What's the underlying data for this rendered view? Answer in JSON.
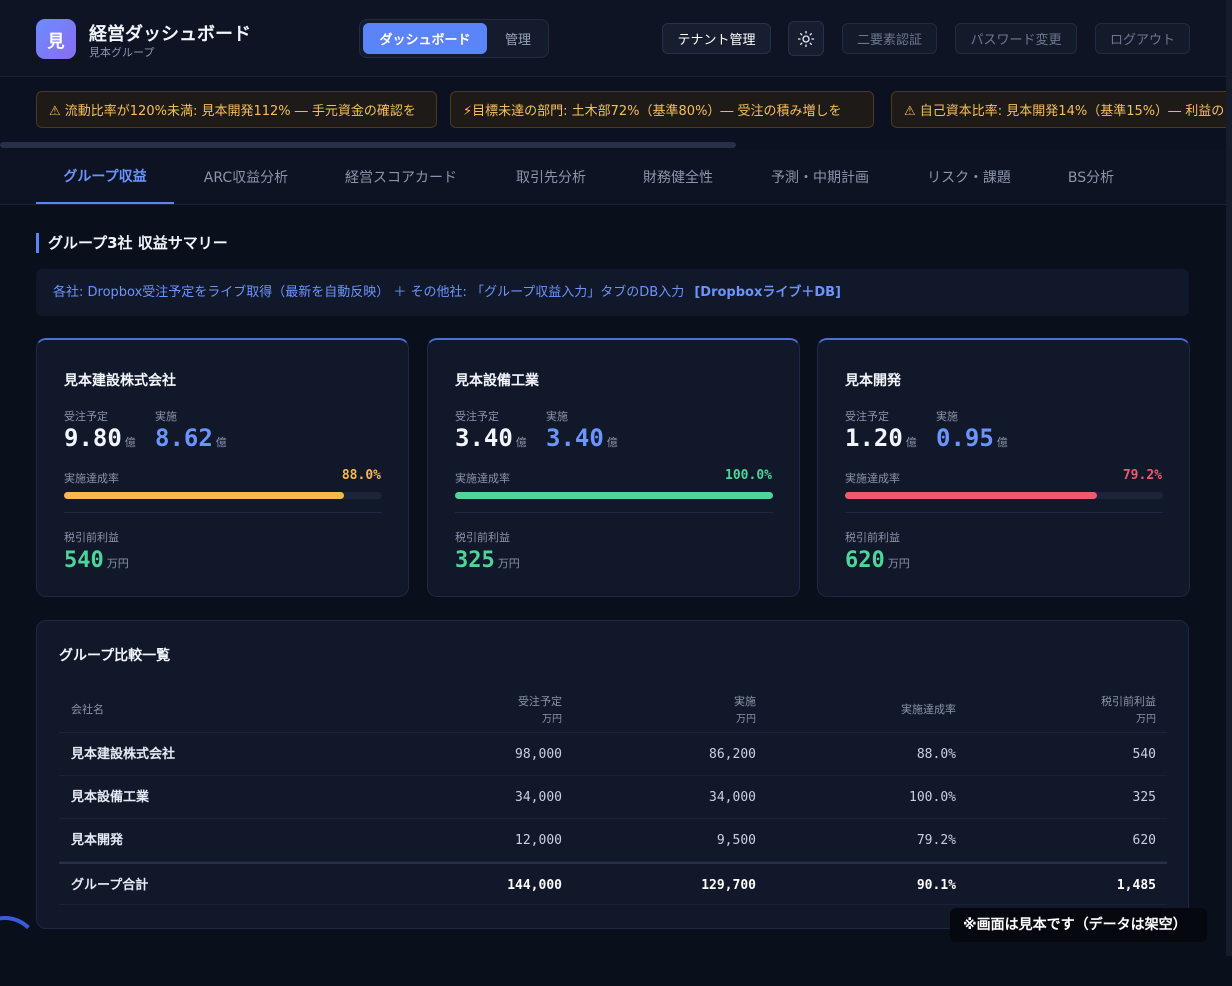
{
  "header": {
    "logo_char": "見",
    "title": "経営ダッシュボード",
    "subtitle": "見本グループ",
    "mode_tabs": [
      "ダッシュボード",
      "管理"
    ],
    "tenant_button": "テナント管理",
    "theme_icon": "sun-icon",
    "buttons": [
      "二要素認証",
      "パスワード変更",
      "ログアウト"
    ]
  },
  "alerts": [
    "⚠ 流動比率が120%未満: 見本開発112% ― 手元資金の確認を",
    "⚡目標未達の部門: 土木部72%（基準80%）― 受注の積み増しを",
    "⚠ 自己資本比率: 見本開発14%（基準15%）― 利益の"
  ],
  "tabs": [
    "グループ収益",
    "ARC収益分析",
    "経営スコアカード",
    "取引先分析",
    "財務健全性",
    "予測・中期計画",
    "リスク・課題",
    "BS分析"
  ],
  "section": {
    "title": "グループ3社 収益サマリー",
    "info": "各社: Dropbox受注予定をライブ取得（最新を自動反映） ＋ その他社: 「グループ収益入力」タブのDB入力",
    "info_tag": "[Dropboxライブ＋DB]"
  },
  "labels": {
    "order": "受注予定",
    "actual": "実施",
    "rate": "実施達成率",
    "profit": "税引前利益",
    "oku": "億",
    "man": "万円"
  },
  "companies": [
    {
      "name": "見本建設株式会社",
      "order": "9.80",
      "actual": "8.62",
      "rate": "88.0%",
      "rate_value": 0.88,
      "profit": "540",
      "color": "#f5b94e"
    },
    {
      "name": "見本設備工業",
      "order": "3.40",
      "actual": "3.40",
      "rate": "100.0%",
      "rate_value": 1.0,
      "profit": "325",
      "color": "#4fd49a"
    },
    {
      "name": "見本開発",
      "order": "1.20",
      "actual": "0.95",
      "rate": "79.2%",
      "rate_value": 0.792,
      "profit": "620",
      "color": "#ee5b6e"
    }
  ],
  "table": {
    "title": "グループ比較一覧",
    "headers": [
      "会社名",
      "受注予定",
      "実施",
      "実施達成率",
      "税引前利益"
    ],
    "units": [
      "",
      "万円",
      "万円",
      "",
      "万円"
    ],
    "rows": [
      [
        "見本建設株式会社",
        "98,000",
        "86,200",
        "88.0%",
        "540"
      ],
      [
        "見本設備工業",
        "34,000",
        "34,000",
        "100.0%",
        "325"
      ],
      [
        "見本開発",
        "12,000",
        "9,500",
        "79.2%",
        "620"
      ]
    ],
    "total": [
      "グループ合計",
      "144,000",
      "129,700",
      "90.1%",
      "1,485"
    ]
  },
  "notice": "※画面は見本です（データは架空）"
}
